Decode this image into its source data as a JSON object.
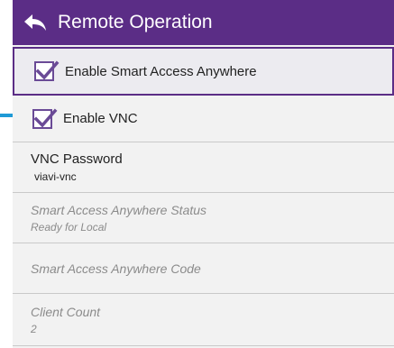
{
  "header": {
    "title": "Remote Operation",
    "back_icon": "back-arrow-icon",
    "color": "#5b2d86"
  },
  "settings": {
    "enable_saa": {
      "label": "Enable Smart Access Anywhere",
      "checked": true
    },
    "enable_vnc": {
      "label": "Enable VNC",
      "checked": true
    },
    "vnc_password": {
      "label": "VNC Password",
      "value": "viavi-vnc"
    },
    "saa_status": {
      "label": "Smart Access Anywhere Status",
      "value": "Ready for Local"
    },
    "saa_code": {
      "label": "Smart Access Anywhere Code"
    },
    "client_count": {
      "label": "Client Count",
      "value": "2"
    }
  },
  "colors": {
    "accent": "#5b2d86",
    "pointer": "#1f9ad6",
    "disabled_text": "#8b8b8b"
  }
}
